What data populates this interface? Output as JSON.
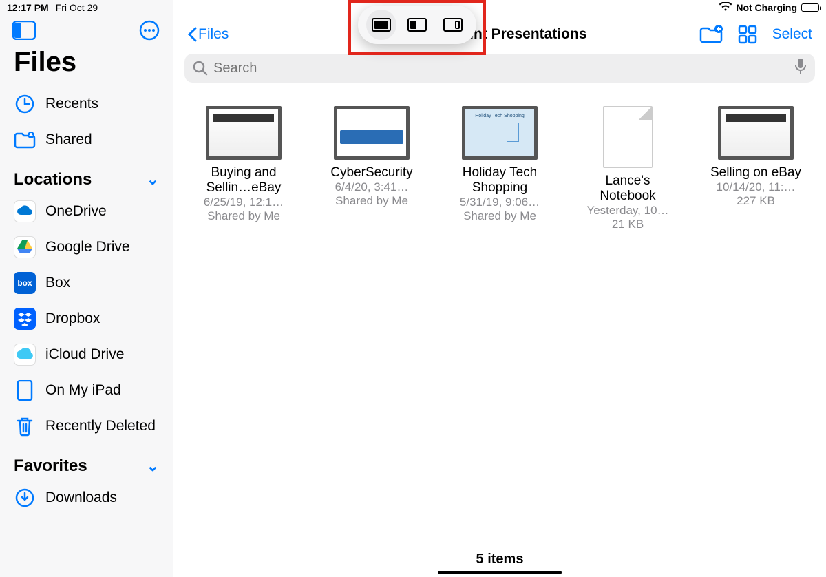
{
  "status": {
    "time": "12:17 PM",
    "date": "Fri Oct 29",
    "charging": "Not Charging"
  },
  "sidebar": {
    "title": "Files",
    "recents": "Recents",
    "shared": "Shared",
    "locations_header": "Locations",
    "favorites_header": "Favorites",
    "locations": [
      {
        "label": "OneDrive"
      },
      {
        "label": "Google Drive"
      },
      {
        "label": "Box"
      },
      {
        "label": "Dropbox"
      },
      {
        "label": "iCloud Drive"
      },
      {
        "label": "On My iPad"
      },
      {
        "label": "Recently Deleted"
      }
    ],
    "favorites": [
      {
        "label": "Downloads"
      }
    ]
  },
  "nav": {
    "back": "Files",
    "title": "erPoint Presentations",
    "select": "Select"
  },
  "search": {
    "placeholder": "Search"
  },
  "files": [
    {
      "name": "Buying and Sellin…eBay",
      "meta": "6/25/19, 12:1…",
      "sub": "Shared by Me",
      "type": "ppt"
    },
    {
      "name": "CyberSecurity",
      "meta": "6/4/20, 3:41…",
      "sub": "Shared by Me",
      "type": "ppt"
    },
    {
      "name": "Holiday Tech Shopping",
      "meta": "5/31/19, 9:06…",
      "sub": "Shared by Me",
      "type": "ppt"
    },
    {
      "name": "Lance's Notebook",
      "meta": "Yesterday, 10…",
      "sub": "21 KB",
      "type": "doc"
    },
    {
      "name": "Selling on eBay",
      "meta": "10/14/20, 11:…",
      "sub": "227 KB",
      "type": "ppt"
    }
  ],
  "footer": {
    "count": "5 items"
  }
}
